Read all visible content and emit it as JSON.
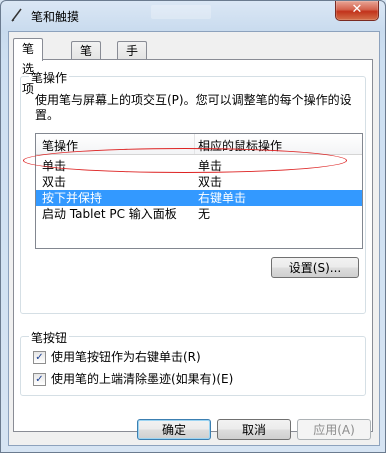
{
  "window": {
    "title": "笔和触摸",
    "close_glyph": "✕"
  },
  "tabs": [
    {
      "label": "笔选项",
      "active": true
    },
    {
      "label": "笔势",
      "active": false
    },
    {
      "label": "手写",
      "active": false
    }
  ],
  "pen_actions": {
    "group_title": "笔操作",
    "description": "使用笔与屏幕上的项交互(P)。您可以调整笔的每个操作的设置。",
    "columns": [
      "笔操作",
      "相应的鼠标操作"
    ],
    "rows": [
      {
        "action": "单击",
        "mouse": "单击",
        "selected": false
      },
      {
        "action": "双击",
        "mouse": "双击",
        "selected": false
      },
      {
        "action": "按下并保持",
        "mouse": "右键单击",
        "selected": true
      },
      {
        "action": "启动 Tablet PC 输入面板",
        "mouse": "无",
        "selected": false
      }
    ],
    "settings_button": "设置(S)..."
  },
  "pen_buttons": {
    "group_title": "笔按钮",
    "options": [
      {
        "label": "使用笔按钮作为右键单击(R)",
        "checked": true
      },
      {
        "label": "使用笔的上端清除墨迹(如果有)(E)",
        "checked": true
      }
    ]
  },
  "footer": {
    "ok": "确定",
    "cancel": "取消",
    "apply": "应用(A)"
  },
  "colors": {
    "selection": "#3399ff",
    "annotation_ellipse": "#dd2222"
  }
}
